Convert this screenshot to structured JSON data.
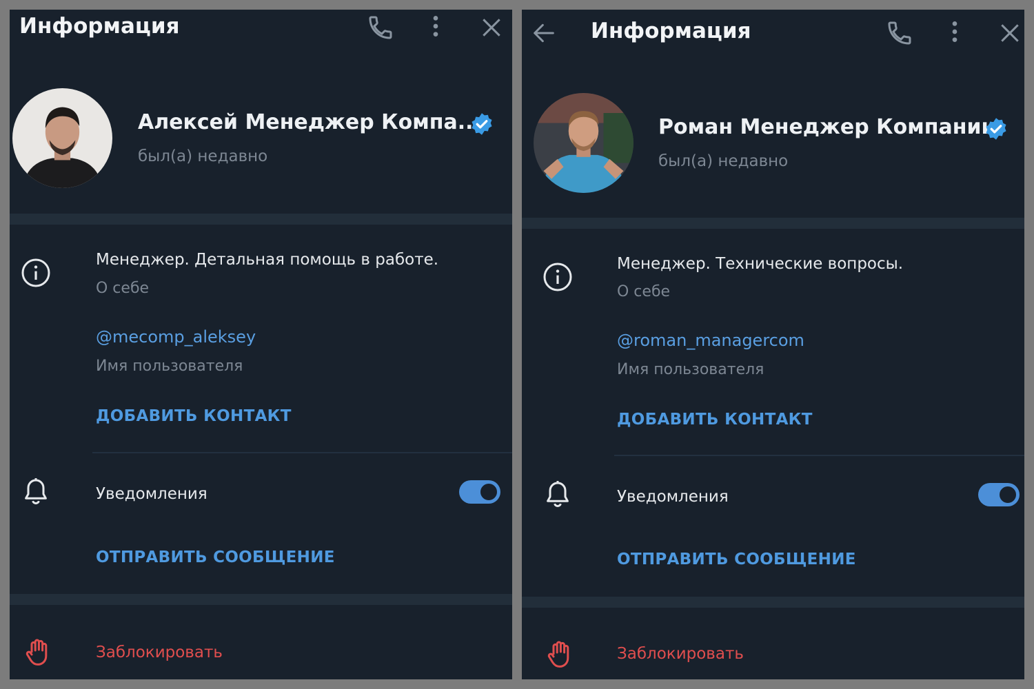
{
  "left": {
    "header": {
      "title": "Информация",
      "phone_icon": "phone-icon",
      "menu_icon": "more-vertical-icon",
      "close_icon": "close-icon"
    },
    "profile": {
      "name": "Алексей Менеджер Компа...",
      "status": "был(а) недавно"
    },
    "about": {
      "value": "Менеджер. Детальная помощь в работе.",
      "label": "О себе"
    },
    "username": {
      "value": "@mecomp_aleksey",
      "label": "Имя пользователя"
    },
    "add_contact": "ДОБАВИТЬ КОНТАКТ",
    "notifications": {
      "label": "Уведомления",
      "enabled": true
    },
    "send_message": "ОТПРАВИТЬ СООБЩЕНИЕ",
    "block": "Заблокировать"
  },
  "right": {
    "header": {
      "title": "Информация",
      "back_icon": "arrow-left-icon",
      "phone_icon": "phone-icon",
      "menu_icon": "more-vertical-icon",
      "close_icon": "close-icon"
    },
    "profile": {
      "name": "Роман Менеджер Компании",
      "status": "был(а) недавно"
    },
    "about": {
      "value": "Менеджер. Технические вопросы.",
      "label": "О себе"
    },
    "username": {
      "value": "@roman_managercom",
      "label": "Имя пользователя"
    },
    "add_contact": "ДОБАВИТЬ КОНТАКТ",
    "notifications": {
      "label": "Уведомления",
      "enabled": true
    },
    "send_message": "ОТПРАВИТЬ СООБЩЕНИЕ",
    "block": "Заблокировать"
  },
  "colors": {
    "panel_bg": "#18212c",
    "accent": "#4f9ae0",
    "danger": "#e04e4e",
    "muted": "#7d8793",
    "verified_badge": "#3a9be5"
  }
}
